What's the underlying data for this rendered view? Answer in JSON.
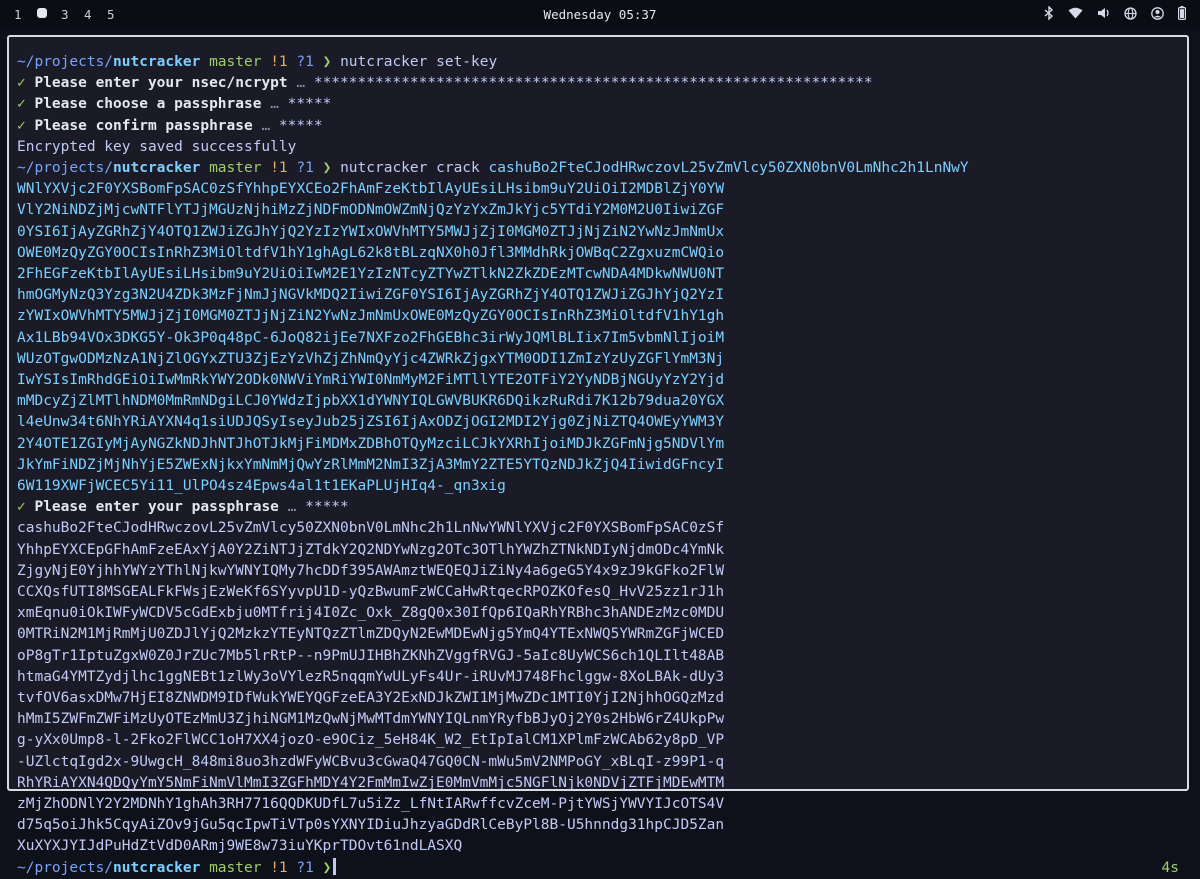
{
  "topbar": {
    "workspaces": [
      "1",
      "3",
      "4",
      "5"
    ],
    "active_workspace_index": 1,
    "clock": "Wednesday 05:37",
    "tray_icons": [
      "bluetooth-icon",
      "wifi-icon",
      "volume-icon",
      "globe-icon",
      "account-icon",
      "battery-icon"
    ]
  },
  "terminal": {
    "prompt": {
      "path_prefix": "~/projects/",
      "path_dir": "nutcracker",
      "branch": "master",
      "modified": "!1",
      "untracked": "?1",
      "symbol": "❯"
    },
    "commands": {
      "set_key": "nutcracker set-key",
      "crack": "nutcracker crack",
      "crack_arg": "cashuBo2FteCJodHRwczovL25vZmVlcy50ZXN0bnV0LmNhc2h1LnNwYWNlYXVjc2F0YXSBomFpSAC0zSfYhhpEYXCEo2FhAmFzeKtbIlAyUEsiLHsibm9uY2UiOiI2MDBlZjY0YWVlY2NiNDZjMjcwNTFlYTJjMGUzNjhiMzZjNDFmODNmOWZmNjQzYzYxZmJkYjc5YTdiY2M0M2U0IiwiZGF0YSI6IjAyZGRhZjY4OTQ1ZWJiZGJhYjQ2YzIzYWIxOWVhMTY5MWJjZjI0MGM0ZTJjNjZiN2YwNzJmNmUxOWE0MzQyZGY0OCIsInRhZ3MiOltdfV1hY1ghAgL62k8tBLzqNX0h0Jfl3MMdhRkjOWBqC2ZgxuzmCWQio2FhEGFzeKtbIlAyUEsiLHsibm9uY2UiOiIwM2E1YzIzNTcyZTYwZTlkN2ZkZDEzMTcwNDA4MDkwNWU0NThmOGMyNzQ3Yzg3N2U4ZDk3MzFjNmJjNGVkMDQ2IiwiZGF0YSI6IjAyZGRhZjY4OTQ1ZWJiZGJhYjQ2YzIzYWIxOWVhMTY5MWJjZjI0MGM0ZTJjNjZiN2YwNzJmNmUxOWE0MzQyZGY0OCIsInRhZ3MiOltdfV1hY1ghAx1LBb94VOx3DKG5Y-Ok3P0q48pC-6JoQ82ijEe7NXFzo2FhGEBhc3irWyJQMlBLIix7Im5vbmNlIjoiMWUzOTgwODMzNzA1NjZlOGYxZTU3ZjEzYzVhZjZhNmQyYjc4ZWRkZjgxYTM0ODI1ZmIzYzUyZGFlYmM3NjIwYSIsImRhdGEiOiIwMmRkYWY2ODk0NWViYmRiYWI0NmMyM2FiMTllYTE2OTFiY2YyNDBjNGUyYzY2YjdmMDcyZjZlMTlhNDM0MmRmNDgiLCJ0YWdzIjpbXX1dYWNYIQLGWVBUKR6DQikzRuRdi7K12b79dua20YGXl4eUnw34t6NhYRiAYXN4q1siUDJQSyIseyJub25jZSI6IjAxODZjOGI2MDI2Yjg0ZjNiZTQ4OWEyYWM3Y2Y4OTE1ZGIyMjAyNGZkNDJhNTJhOTJkMjFiMDMxZDBhOTQyMzciLCJkYXRhIjoiMDJkZGFmNjg5NDVlYmJkYmFiNDZjMjNhYjE5ZWExNjkxYmNmMjQwYzRlMmM2NmI3ZjA3MmY2ZTE5YTQzNDJkZjQ4IiwidGFncyI6W119XWFjWCEC5Yi11_UlPO4sz4Epws4al1t1EKaPLUjHIq4-_qn3xig"
    },
    "prompts": {
      "nsec": "Please enter your nsec/ncrypt",
      "nsec_masked": "****************************************************************",
      "choose": "Please choose a passphrase",
      "confirm": "Please confirm passphrase",
      "enter": "Please enter your passphrase",
      "pass_masked": "*****",
      "ellipsis": "…",
      "check": "✓"
    },
    "messages": {
      "saved": "Encrypted key saved successfully"
    },
    "output_token": "cashuBo2FteCJodHRwczovL25vZmVlcy50ZXN0bnV0LmNhc2h1LnNwYWNlYXVjc2F0YXSBomFpSAC0zSfYhhpEYXCEpGFhAmFzeEAxYjA0Y2ZiNTJjZTdkY2Q2NDYwNzg2OTc3OTlhYWZhZTNkNDIyNjdmODc4YmNkZjgyNjE0YjhhYWYzYThlNjkwYWNYIQMy7hcDDf395AWAmztWEQEQJiZiNy4a6geG5Y4x9zJ9kGFko2FlWCCXQsfUTI8MSGEALFkFWsjEzWeKf6SYyvpU1D-yQzBwumFzWCCaHwRtqecRPOZKOfesQ_HvV25zz1rJ1hxmEqnu0iOkIWFyWCDV5cGdExbju0MTfrij4I0Zc_Oxk_Z8gQ0x30IfQp6IQaRhYRBhc3hANDEzMzc0MDU0MTRiN2M1MjRmMjU0ZDJlYjQ2MzkzYTEyNTQzZTlmZDQyN2EwMDEwNjg5YmQ4YTExNWQ5YWRmZGFjWCEDoP8gTr1IptuZgxW0Z0JrZUc7Mb5lrRtP--n9PmUJIHBhZKNhZVggfRVGJ-5aIc8UyWCS6ch1QLIlt48ABhtmaG4YMTZydjlhc1ggNEBt1zlWy3oVYlezR5nqqmYwULyFs4Ur-iRUvMJ748Fhclggw-8XoLBAk-dUy3tvfOV6asxDMw7HjEI8ZNWDM9IDfWukYWEYQGFzeEA3Y2ExNDJkZWI1MjMwZDc1MTI0YjI2NjhhOGQzMzdhMmI5ZWFmZWFiMzUyOTEzMmU3ZjhiNGM1MzQwNjMwMTdmYWNYIQLnmYRyfbBJyOj2Y0s2HbW6rZ4UkpPwg-yXx0Ump8-l-2Fko2FlWCC1oH7XX4jozO-e9OCiz_5eH84K_W2_EtIpIalCM1XPlmFzWCAb62y8pD_VP-UZlctqIgd2x-9UwgcH_848mi8uo3hzdWFyWCBvu3cGwaQ47GQ0CN-mWu5mV2NMPoGY_xBLqI-z99P1-qRhYRiAYXN4QDQyYmY5NmFiNmVlMmI3ZGFhMDY4Y2FmMmIwZjE0MmVmMjc5NGFlNjk0NDVjZTFjMDEwMTMzMjZhODNlY2Y2MDNhY1ghAh3RH7716QQDKUDfL7u5iZz_LfNtIARwffcvZceM-PjtYWSjYWVYIJcOTS4Vd75q5oiJhk5CqyAiZOv9jGu5qcIpwTiVTp0sYXNYIDiuJhzyaGDdRlCeByPl8B-U5hnndg31hpCJD5ZanXuXYXJYIJdPuHdZtVdD0ARmj9WE8w73iuYKprTDOvt61ndLASXQ",
    "duration": "4s"
  }
}
